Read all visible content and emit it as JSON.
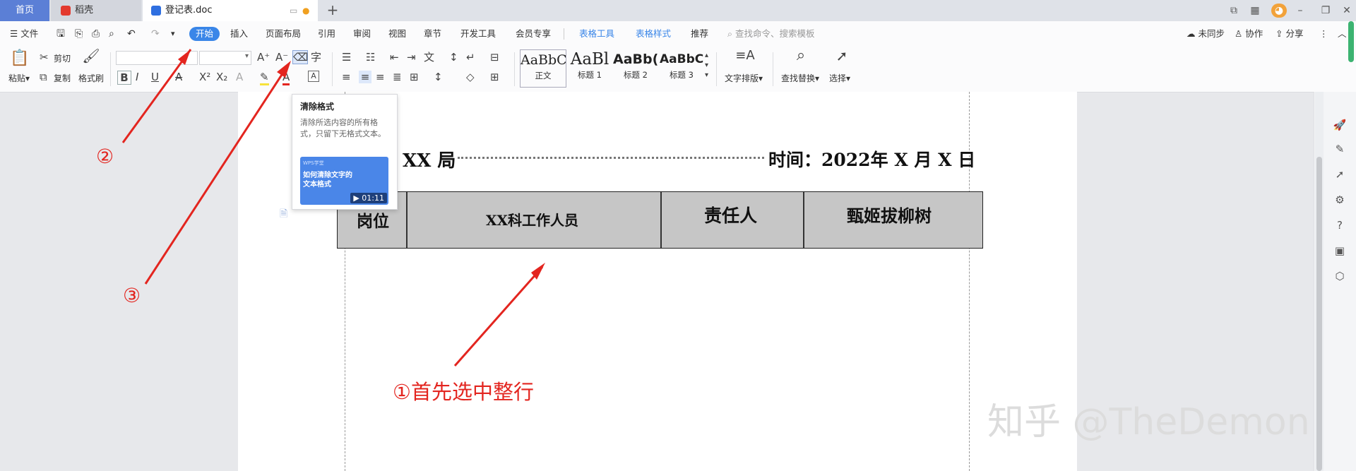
{
  "tabs": {
    "home": "首页",
    "daoke": "稻壳",
    "doc": "登记表.doc"
  },
  "menus": {
    "file": "文件",
    "start": "开始",
    "insert": "插入",
    "layout": "页面布局",
    "ref": "引用",
    "review": "审阅",
    "view": "视图",
    "chapter": "章节",
    "dev": "开发工具",
    "vip": "会员专享",
    "table_tools": "表格工具",
    "table_style": "表格样式",
    "recommend": "推荐",
    "search": "查找命令、搜索模板",
    "unsynced": "未同步",
    "collab": "协作",
    "share": "分享"
  },
  "ribbon": {
    "cut": "剪切",
    "paste": "粘贴",
    "copy": "复制",
    "format_painter": "格式刷",
    "styles": [
      {
        "sample": "AaBbC",
        "name": "正文"
      },
      {
        "sample": "AaBl",
        "name": "标题 1"
      },
      {
        "sample": "AaBb(",
        "name": "标题 2"
      },
      {
        "sample": "AaBbC",
        "name": "标题 3"
      }
    ],
    "text_layout": "文字排版",
    "find_replace": "查找替换",
    "select": "选择"
  },
  "tooltip": {
    "title": "清除格式",
    "desc": "清除所选内容的所有格式，只留下无格式文本。",
    "thumb_tag": "WPS学堂",
    "thumb_title": "如何清除文字的文本格式",
    "duration": "01:11"
  },
  "document": {
    "org": "XX 局",
    "date": "时间：2022年 X 月 X 日",
    "cells": [
      "岗位",
      "XX科工作人员",
      "责任人",
      "甄姬拔柳树"
    ]
  },
  "annotations": {
    "step1": "①首先选中整行",
    "step2": "②",
    "step3": "③"
  },
  "watermark": "知乎 @TheDemon"
}
